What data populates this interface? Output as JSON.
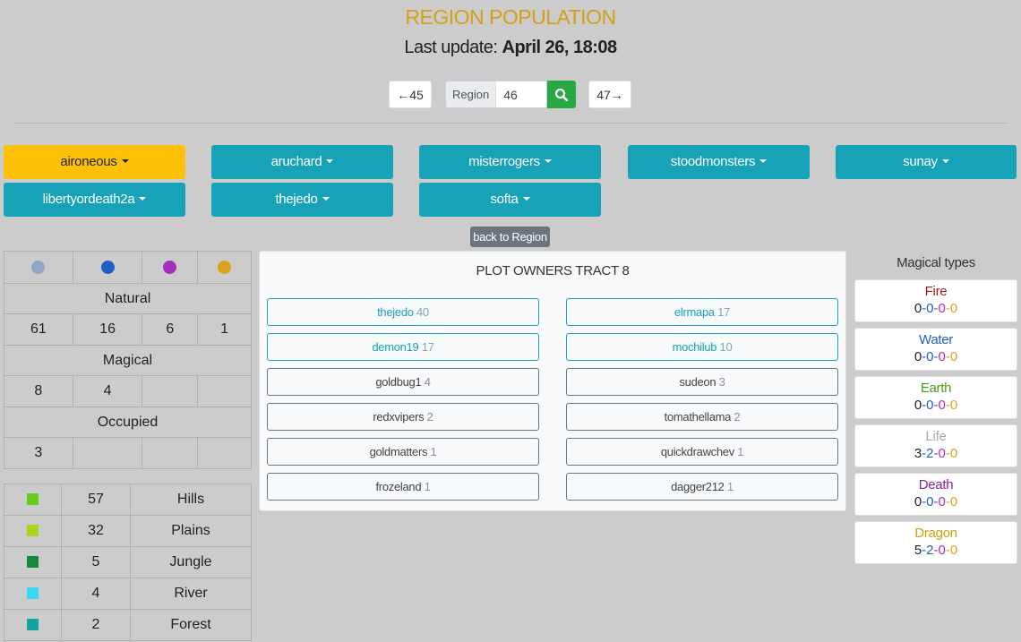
{
  "header": {
    "title": "REGION POPULATION",
    "update_label": "Last update:",
    "update_value": "April 26, 18:08"
  },
  "nav": {
    "prev_label": "←45",
    "next_label": "47→",
    "region_label": "Region",
    "region_value": "46"
  },
  "owners": [
    {
      "name": "aironeous",
      "active": true
    },
    {
      "name": "aruchard"
    },
    {
      "name": "misterrogers"
    },
    {
      "name": "stoodmonsters"
    },
    {
      "name": "sunay"
    },
    {
      "name": "libertyordeath2a"
    },
    {
      "name": "thejedo"
    },
    {
      "name": "softa"
    }
  ],
  "back_label": "back to Region",
  "stats": {
    "dot_colors": [
      "#8fa6c8",
      "#1f5fc4",
      "#a72fbd",
      "#d9a41a"
    ],
    "natural_label": "Natural",
    "natural": [
      "61",
      "16",
      "6",
      "1"
    ],
    "magical_label": "Magical",
    "magical": [
      "8",
      "4",
      "",
      ""
    ],
    "occupied_label": "Occupied",
    "occupied": [
      "3",
      "",
      "",
      ""
    ]
  },
  "terrain": [
    {
      "color": "#66cc1a",
      "count": "57",
      "name": "Hills"
    },
    {
      "color": "#a8d41e",
      "count": "32",
      "name": "Plains"
    },
    {
      "color": "#138a3a",
      "count": "5",
      "name": "Jungle"
    },
    {
      "color": "#3ad7f5",
      "count": "4",
      "name": "River"
    },
    {
      "color": "#13a3a0",
      "count": "2",
      "name": "Forest"
    }
  ],
  "plot_owners": {
    "title": "PLOT OWNERS TRACT 8",
    "items": [
      {
        "name": "thejedo",
        "count": "40",
        "highlight": true
      },
      {
        "name": "elrmapa",
        "count": "17",
        "highlight": true
      },
      {
        "name": "demon19",
        "count": "17",
        "highlight": true
      },
      {
        "name": "mochilub",
        "count": "10",
        "highlight": true
      },
      {
        "name": "goldbug1",
        "count": "4"
      },
      {
        "name": "sudeon",
        "count": "3"
      },
      {
        "name": "redxvipers",
        "count": "2"
      },
      {
        "name": "tomathellama",
        "count": "2"
      },
      {
        "name": "goldmatters",
        "count": "1"
      },
      {
        "name": "quickdrawchev",
        "count": "1"
      },
      {
        "name": "frozeland",
        "count": "1"
      },
      {
        "name": "dagger212",
        "count": "1"
      }
    ]
  },
  "magical_types": {
    "title": "Magical types",
    "value_colors": [
      "#222222",
      "#1f5fc4",
      "#a72fbd",
      "#d9a41a"
    ],
    "items": [
      {
        "name": "Fire",
        "color": "#9b1c1c",
        "values": [
          "0",
          "0",
          "0",
          "0"
        ]
      },
      {
        "name": "Water",
        "color": "#1f5fc4",
        "values": [
          "0",
          "0",
          "0",
          "0"
        ]
      },
      {
        "name": "Earth",
        "color": "#4c9a1a",
        "values": [
          "0",
          "0",
          "0",
          "0"
        ]
      },
      {
        "name": "Life",
        "color": "#a9a9a9",
        "values": [
          "3",
          "2",
          "0",
          "0"
        ]
      },
      {
        "name": "Death",
        "color": "#8b1f9e",
        "values": [
          "0",
          "0",
          "0",
          "0"
        ]
      },
      {
        "name": "Dragon",
        "color": "#c9a010",
        "values": [
          "5",
          "2",
          "0",
          "0"
        ]
      }
    ]
  }
}
